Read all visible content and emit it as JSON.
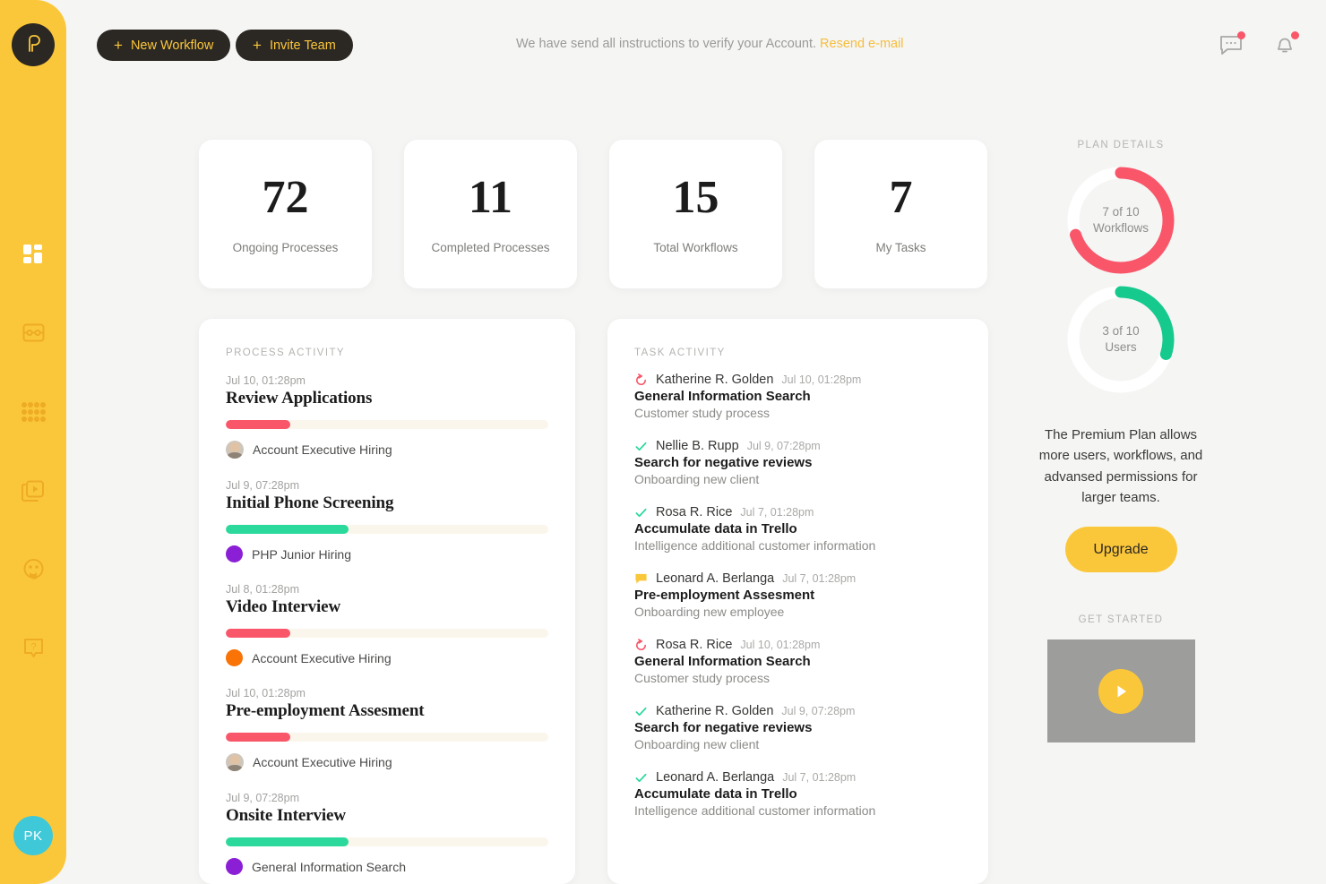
{
  "brand": {
    "logo_letter": "P",
    "accent": "#fbc73a",
    "dark": "#2b2723"
  },
  "sidebar": {
    "items": [
      {
        "name": "dashboard",
        "icon": "grid-dashboard-icon",
        "active": true
      },
      {
        "name": "workflows",
        "icon": "workflow-board-icon",
        "active": false
      },
      {
        "name": "processes",
        "icon": "dots-grid-icon",
        "active": false
      },
      {
        "name": "media",
        "icon": "media-play-icon",
        "active": false
      },
      {
        "name": "support",
        "icon": "support-face-icon",
        "active": false
      },
      {
        "name": "help",
        "icon": "question-help-icon",
        "active": false
      }
    ],
    "user_initials": "PK",
    "user_avatar_color": "#3ec8d8"
  },
  "topbar": {
    "new_workflow_label": "New Workflow",
    "invite_team_label": "Invite Team",
    "plus_glyph": "+",
    "verify_message": "We have send all instructions to verify your Account.",
    "resend_link": "Resend e-mail",
    "message_icon": "chat-message-icon",
    "bell_icon": "notification-bell-icon",
    "badge_color": "#f9566a"
  },
  "stats": [
    {
      "value": "72",
      "label": "Ongoing Processes"
    },
    {
      "value": "11",
      "label": "Completed Processes"
    },
    {
      "value": "15",
      "label": "Total Workflows"
    },
    {
      "value": "7",
      "label": "My Tasks"
    }
  ],
  "process_activity": {
    "title": "PROCESS ACTIVITY",
    "items": [
      {
        "date": "Jul 10, 01:28pm",
        "name": "Review Applications",
        "progress": 20,
        "progress_color": "#f9566a",
        "marker": "avatar",
        "marker_color": "",
        "label": "Account Executive Hiring"
      },
      {
        "date": "Jul 9, 07:28pm",
        "name": "Initial Phone Screening",
        "progress": 38,
        "progress_color": "#2ad99b",
        "marker": "dot",
        "marker_color": "#8b1fd6",
        "label": "PHP Junior Hiring"
      },
      {
        "date": "Jul 8, 01:28pm",
        "name": "Video Interview",
        "progress": 20,
        "progress_color": "#f9566a",
        "marker": "dot",
        "marker_color": "#f97306",
        "label": "Account Executive Hiring"
      },
      {
        "date": "Jul 10, 01:28pm",
        "name": "Pre-employment Assesment",
        "progress": 20,
        "progress_color": "#f9566a",
        "marker": "avatar",
        "marker_color": "",
        "label": "Account Executive Hiring"
      },
      {
        "date": "Jul 9, 07:28pm",
        "name": "Onsite Interview",
        "progress": 38,
        "progress_color": "#2ad99b",
        "marker": "dot",
        "marker_color": "#8b1fd6",
        "label": "General Information Search"
      }
    ]
  },
  "task_activity": {
    "title": "TASK ACTIVITY",
    "items": [
      {
        "icon": "rotate-pending-icon",
        "icon_color": "#f9566a",
        "person": "Katherine R. Golden",
        "date": "Jul 10, 01:28pm",
        "title": "General Information Search",
        "subtitle": "Customer study process"
      },
      {
        "icon": "check-done-icon",
        "icon_color": "#2ad99b",
        "person": "Nellie B. Rupp",
        "date": "Jul 9, 07:28pm",
        "title": "Search for negative reviews",
        "subtitle": "Onboarding new client"
      },
      {
        "icon": "check-done-icon",
        "icon_color": "#2ad99b",
        "person": "Rosa R. Rice",
        "date": "Jul 7, 01:28pm",
        "title": "Accumulate data in Trello",
        "subtitle": "Intelligence additional customer information"
      },
      {
        "icon": "comment-icon",
        "icon_color": "#fbc73a",
        "person": "Leonard A. Berlanga",
        "date": "Jul 7, 01:28pm",
        "title": "Pre-employment Assesment",
        "subtitle": "Onboarding new employee"
      },
      {
        "icon": "rotate-pending-icon",
        "icon_color": "#f9566a",
        "person": "Rosa R. Rice",
        "date": "Jul 10, 01:28pm",
        "title": "General Information Search",
        "subtitle": "Customer study process"
      },
      {
        "icon": "check-done-icon",
        "icon_color": "#2ad99b",
        "person": "Katherine R. Golden",
        "date": "Jul 9, 07:28pm",
        "title": "Search for negative reviews",
        "subtitle": "Onboarding new client"
      },
      {
        "icon": "check-done-icon",
        "icon_color": "#2ad99b",
        "person": "Leonard A. Berlanga",
        "date": "Jul 7, 01:28pm",
        "title": "Accumulate data in Trello",
        "subtitle": "Intelligence additional customer information"
      }
    ]
  },
  "plan": {
    "heading": "PLAN DETAILS",
    "rings": [
      {
        "value": 7,
        "max": 10,
        "count_text": "7 of 10",
        "unit_text": "Workflows",
        "color": "#f9566a",
        "track": "#ffffff",
        "percent": 70
      },
      {
        "value": 3,
        "max": 10,
        "count_text": "3 of 10",
        "unit_text": "Users",
        "color": "#16c98d",
        "track": "#ffffff",
        "percent": 30
      }
    ],
    "description": "The Premium Plan allows more users, workflows, and advansed permissions for larger teams.",
    "upgrade_label": "Upgrade"
  },
  "get_started": {
    "heading": "GET STARTED",
    "play_icon": "play-triangle-icon",
    "thumbnail_color": "#9d9d9c"
  },
  "chart_data": {
    "type": "pie",
    "title": "Plan usage donuts",
    "series": [
      {
        "name": "Workflows",
        "value": 7,
        "max": 10,
        "percent": 70,
        "color": "#f9566a"
      },
      {
        "name": "Users",
        "value": 3,
        "max": 10,
        "percent": 30,
        "color": "#16c98d"
      }
    ]
  }
}
